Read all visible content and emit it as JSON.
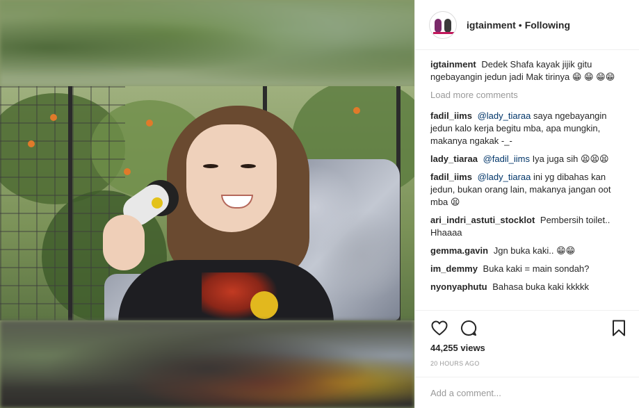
{
  "header": {
    "username": "igtainment",
    "separator": "•",
    "follow_status": "Following"
  },
  "caption": {
    "author": "igtainment",
    "text": "Dedek Shafa kayak jijik gitu ngebayangin jedun jadi Mak tirinya",
    "emoji": "😁 😁 😁😁"
  },
  "load_more": "Load more comments",
  "comments": [
    {
      "author": "fadil_iims",
      "mention": "@lady_tiaraa",
      "text": " saya ngebayangin jedun kalo kerja begitu mba, apa mungkin, makanya ngakak -_-",
      "emoji": ""
    },
    {
      "author": "lady_tiaraa",
      "mention": "@fadil_iims",
      "text": " Iya juga sih",
      "emoji": "😫😫😫"
    },
    {
      "author": "fadil_iims",
      "mention": "@lady_tiaraa",
      "text": " ini yg dibahas kan jedun, bukan orang lain, makanya jangan oot mba",
      "emoji": "😫"
    },
    {
      "author": "ari_indri_astuti_stocklot",
      "mention": "",
      "text": "Pembersih toilet.. Hhaaaa",
      "emoji": ""
    },
    {
      "author": "gemma.gavin",
      "mention": "",
      "text": "Jgn buka kaki..",
      "emoji": "😁😁"
    },
    {
      "author": "im_demmy",
      "mention": "",
      "text": "Buka kaki = main sondah?",
      "emoji": ""
    },
    {
      "author": "nyonyaphutu",
      "mention": "",
      "text": "Bahasa buka kaki kkkkk",
      "emoji": ""
    }
  ],
  "stats": {
    "views": "44,255 views",
    "timestamp": "20 HOURS AGO"
  },
  "add_comment": {
    "placeholder": "Add a comment..."
  },
  "icons": [
    "heart-icon",
    "comment-icon",
    "bookmark-icon"
  ]
}
